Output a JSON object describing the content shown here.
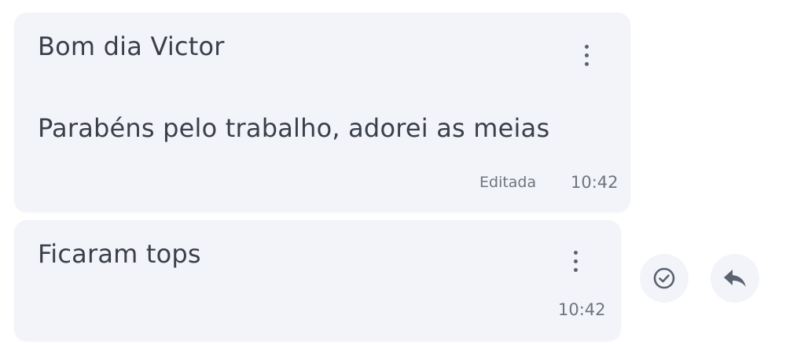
{
  "messages": [
    {
      "lines": [
        "Bom dia Victor",
        "Parabéns pelo trabalho, adorei as meias"
      ],
      "edited_label": "Editada",
      "time": "10:42",
      "menu_icon": "more-vertical-icon"
    },
    {
      "lines": [
        "Ficaram tops"
      ],
      "time": "10:42",
      "menu_icon": "more-vertical-icon"
    }
  ],
  "actions": {
    "read_icon": "check-circle-icon",
    "reply_icon": "reply-icon"
  },
  "colors": {
    "bubble_bg": "#f2f4fa",
    "text": "#3a3f4a",
    "meta_text": "#6e7480",
    "icon": "#5b6270"
  }
}
